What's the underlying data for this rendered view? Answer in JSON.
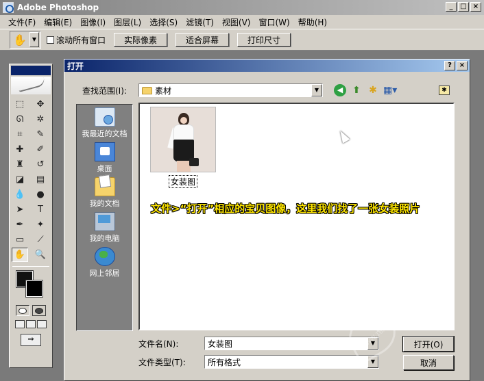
{
  "app": {
    "title": "Adobe Photoshop",
    "window_buttons": [
      "_",
      "□",
      "×"
    ]
  },
  "menubar": {
    "items": [
      "文件(F)",
      "编辑(E)",
      "图像(I)",
      "图层(L)",
      "选择(S)",
      "滤镜(T)",
      "视图(V)",
      "窗口(W)",
      "帮助(H)"
    ]
  },
  "options_bar": {
    "tool_icon": "hand-icon",
    "scroll_all_label": "滚动所有窗口",
    "scroll_all_checked": false,
    "buttons": [
      "实际像素",
      "适合屏幕",
      "打印尺寸"
    ]
  },
  "toolbox": {
    "tools": [
      "marquee-icon",
      "move-icon",
      "lasso-icon",
      "magic-wand-icon",
      "crop-icon",
      "slice-icon",
      "healing-brush-icon",
      "brush-icon",
      "clone-stamp-icon",
      "history-brush-icon",
      "eraser-icon",
      "gradient-icon",
      "blur-icon",
      "dodge-icon",
      "path-selection-icon",
      "type-icon",
      "pen-icon",
      "shape-icon",
      "notes-icon",
      "eyedropper-icon",
      "hand-icon",
      "zoom-icon"
    ],
    "active_tool": "hand-icon",
    "foreground_color": "#111111",
    "background_color": "#000000"
  },
  "dialog": {
    "title": "打开",
    "title_buttons": [
      "?",
      "×"
    ],
    "lookin_label": "查找范围(I):",
    "lookin_value": "素材",
    "places": [
      {
        "label": "我最近的文档",
        "icon": "recent-documents-icon"
      },
      {
        "label": "桌面",
        "icon": "desktop-icon"
      },
      {
        "label": "我的文档",
        "icon": "my-documents-icon"
      },
      {
        "label": "我的电脑",
        "icon": "my-computer-icon"
      },
      {
        "label": "网上邻居",
        "icon": "network-places-icon"
      }
    ],
    "files": [
      {
        "name": "女装图"
      }
    ],
    "annotation": "文件>“打开”相应的宝贝图像，这里我们找了一张女装照片",
    "filename_label": "文件名(N):",
    "filename_value": "女装图",
    "filetype_label": "文件类型(T):",
    "filetype_value": "所有格式",
    "open_button": "打开(O)",
    "cancel_button": "取消"
  },
  "watermark": {
    "text": "凤凰社",
    "url": "WWW.16XX8.COM"
  }
}
